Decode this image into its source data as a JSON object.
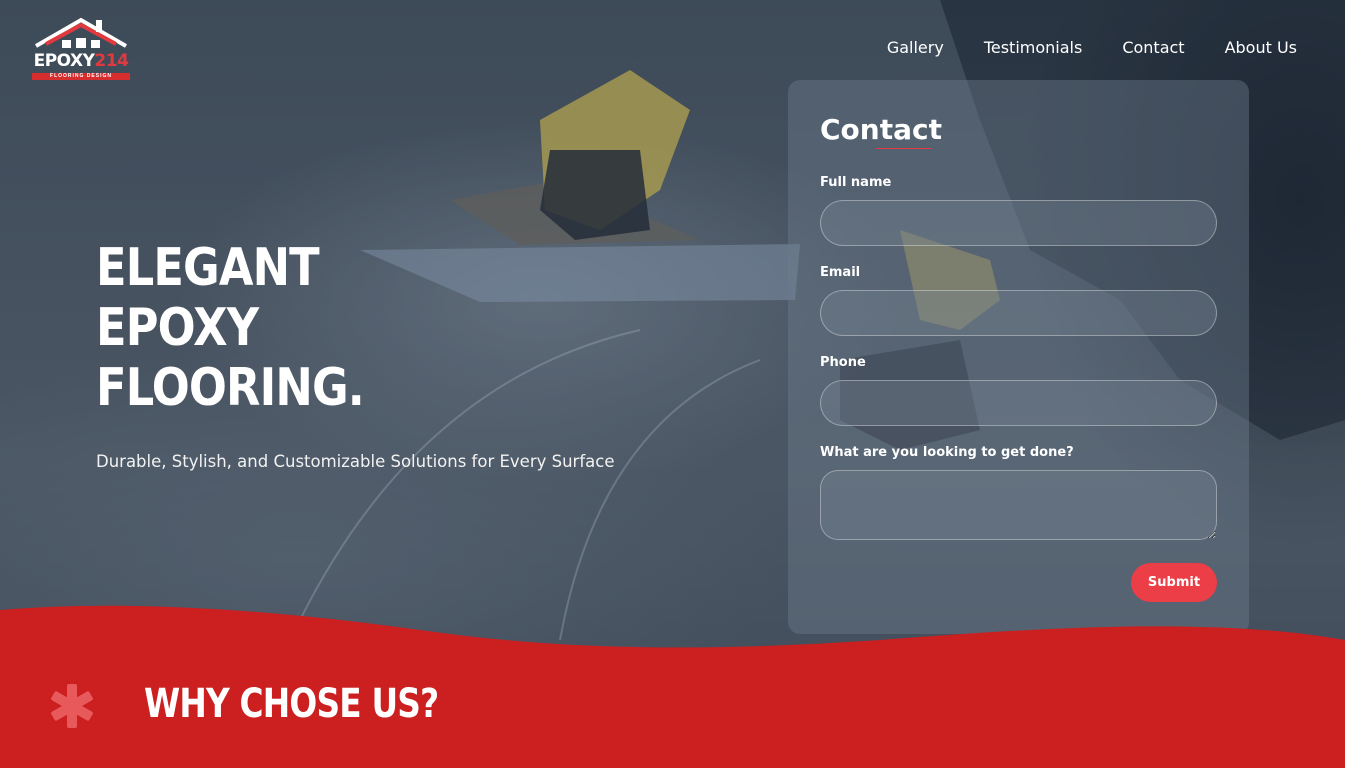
{
  "brand": {
    "logo_text_white": "EPOXY",
    "logo_text_red": "214",
    "logo_tagline": "FLOORING DESIGN",
    "primary_red": "#d01f22",
    "accent_red": "#ec3e46"
  },
  "nav": {
    "items": [
      {
        "label": "Gallery"
      },
      {
        "label": "Testimonials"
      },
      {
        "label": "Contact"
      },
      {
        "label": "About Us"
      }
    ]
  },
  "hero": {
    "title_lines": [
      "ELEGANT",
      "EPOXY",
      "FLOORING."
    ],
    "subtitle": "Durable, Stylish, and Customizable Solutions for Every Surface"
  },
  "contact_form": {
    "title": "Contact",
    "fields": {
      "full_name": {
        "label": "Full name",
        "value": ""
      },
      "email": {
        "label": "Email",
        "value": ""
      },
      "phone": {
        "label": "Phone",
        "value": ""
      },
      "message": {
        "label": "What are you looking to get done?",
        "value": ""
      }
    },
    "submit_label": "Submit"
  },
  "why_section": {
    "title": "WHY CHOSE US?",
    "icon": "asterisk-icon"
  }
}
